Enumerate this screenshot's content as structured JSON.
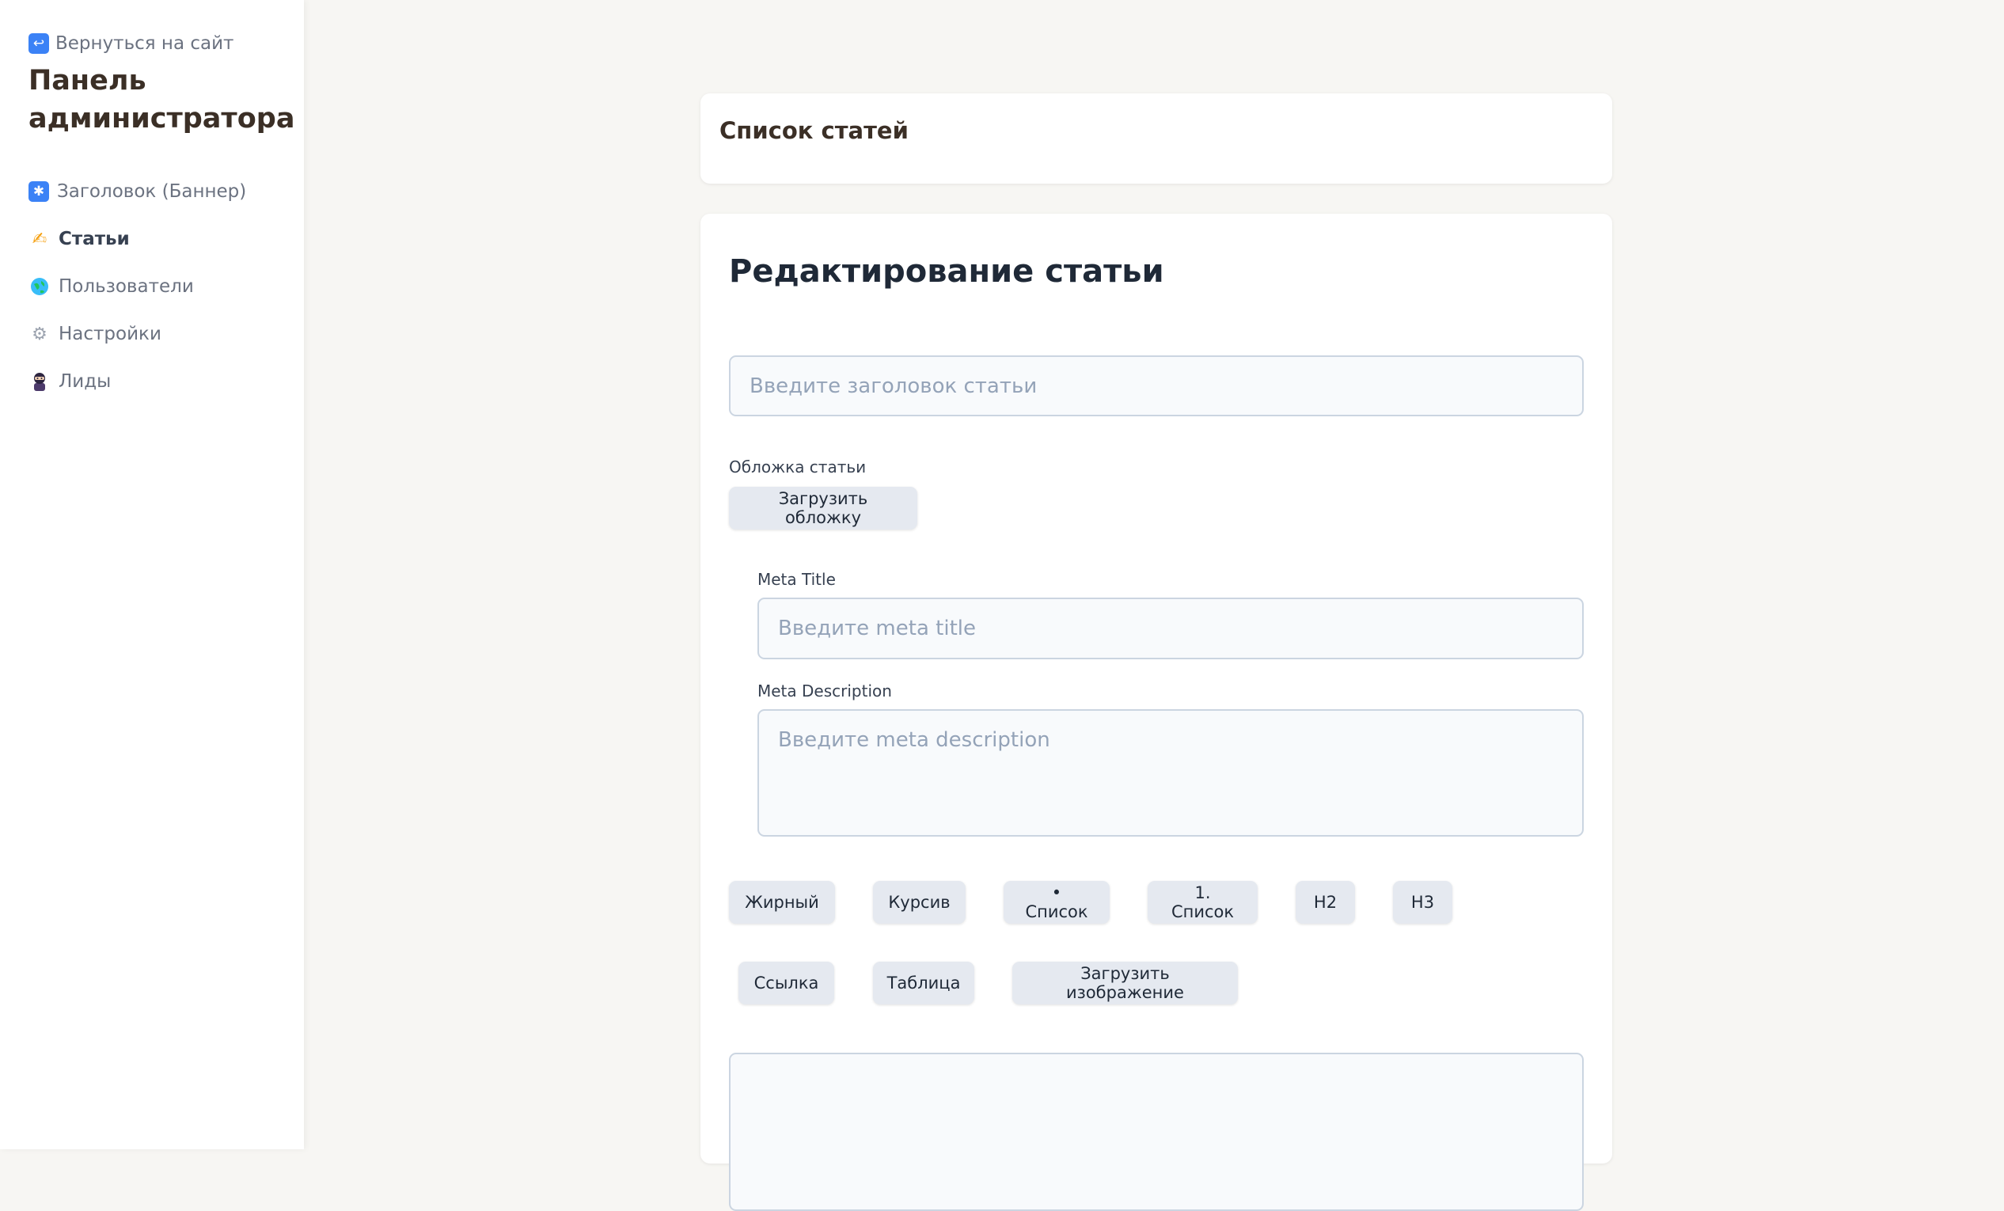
{
  "sidebar": {
    "back_link": "Вернуться на сайт",
    "title": "Панель администратора",
    "items": [
      {
        "label": "Заголовок (Баннер)",
        "icon": "asterisk-icon"
      },
      {
        "label": "Статьи",
        "icon": "writing-hand-icon",
        "active": true
      },
      {
        "label": "Пользователи",
        "icon": "globe-icon"
      },
      {
        "label": "Настройки",
        "icon": "gear-icon"
      },
      {
        "label": "Лиды",
        "icon": "ninja-icon"
      }
    ]
  },
  "list_card": {
    "title": "Список статей"
  },
  "editor": {
    "title": "Редактирование статьи",
    "title_placeholder": "Введите заголовок статьи",
    "cover_label": "Обложка статьи",
    "cover_button": "Загрузить обложку",
    "meta_title_label": "Meta Title",
    "meta_title_placeholder": "Введите meta title",
    "meta_description_label": "Meta Description",
    "meta_description_placeholder": "Введите meta description",
    "toolbar": {
      "bold": "Жирный",
      "italic": "Курсив",
      "bullet_list": "• Список",
      "numbered_list": "1. Список",
      "h2": "H2",
      "h3": "H3",
      "link": "Ссылка",
      "table": "Таблица",
      "upload_image": "Загрузить изображение"
    }
  },
  "colors": {
    "accent_title": "#3b2f26",
    "button_bg": "#e5e9f0",
    "page_bg": "#f7f6f3"
  }
}
